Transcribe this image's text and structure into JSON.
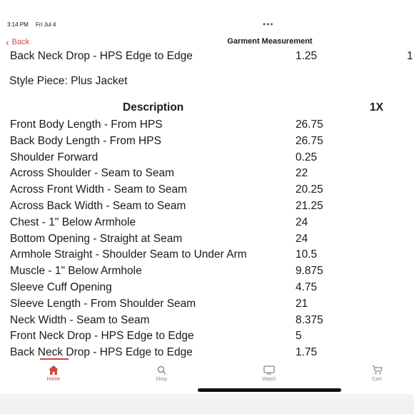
{
  "status": {
    "time": "3:14 PM",
    "date": "Fri Jul 4",
    "dots": "•••"
  },
  "nav": {
    "back_label": "Back",
    "title": "Garment Measurement"
  },
  "partial_row": {
    "description": "Back Neck Drop - HPS Edge to Edge",
    "value": "1.25",
    "extra": "1"
  },
  "style_piece": "Style Piece: Plus Jacket",
  "table": {
    "header": {
      "description": "Description",
      "size": "1X"
    },
    "rows": [
      {
        "description": "Front Body Length - From HPS",
        "value": "26.75"
      },
      {
        "description": "Back Body Length - From HPS",
        "value": "26.75"
      },
      {
        "description": "Shoulder Forward",
        "value": "0.25"
      },
      {
        "description": "Across Shoulder - Seam to Seam",
        "value": "22"
      },
      {
        "description": "Across Front Width - Seam to Seam",
        "value": "20.25"
      },
      {
        "description": "Across Back Width - Seam to Seam",
        "value": "21.25"
      },
      {
        "description": "Chest - 1\" Below Armhole",
        "value": "24"
      },
      {
        "description": "Bottom Opening - Straight at Seam",
        "value": "24"
      },
      {
        "description": "Armhole Straight - Shoulder Seam to Under Arm",
        "value": "10.5"
      },
      {
        "description": "Muscle - 1\" Below Armhole",
        "value": "9.875"
      },
      {
        "description": "Sleeve Cuff Opening",
        "value": "4.75"
      },
      {
        "description": "Sleeve Length - From Shoulder Seam",
        "value": "21"
      },
      {
        "description": "Neck Width - Seam to Seam",
        "value": "8.375"
      },
      {
        "description": "Front Neck Drop - HPS Edge to Edge",
        "value": "5"
      },
      {
        "description": "Back Neck Drop - HPS Edge to Edge",
        "value": "1.75"
      }
    ]
  },
  "tabs": [
    {
      "label": "Home",
      "icon": "home-icon",
      "active": true
    },
    {
      "label": "Shop",
      "icon": "search-icon",
      "active": false
    },
    {
      "label": "Watch",
      "icon": "tv-icon",
      "active": false
    },
    {
      "label": "Cart",
      "icon": "cart-icon",
      "active": false
    }
  ],
  "colors": {
    "accent": "#d0473b",
    "inactive": "#8a8a8a"
  }
}
